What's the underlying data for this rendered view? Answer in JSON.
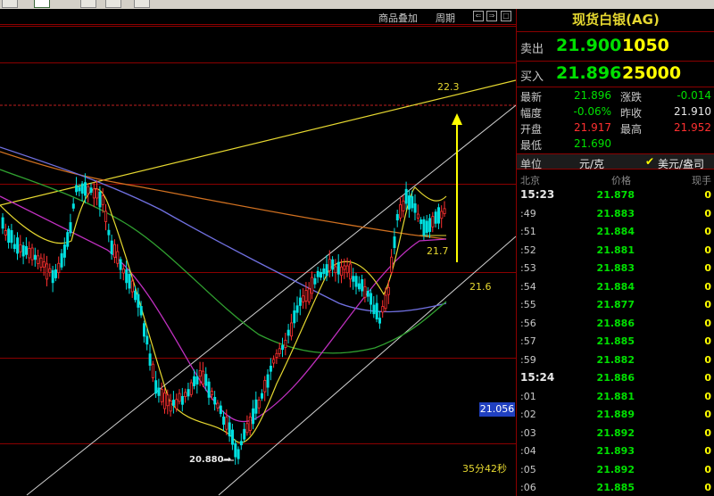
{
  "chart": {
    "header": {
      "overlay_label": "商品叠加",
      "period_label": "周期"
    },
    "annotations": {
      "upper_target": "22.3",
      "mid_level": "21.7",
      "support_level": "21.6",
      "low_marker": "20.880→",
      "current_price": "21.056",
      "countdown": "35分42秒"
    }
  },
  "quote": {
    "title": "现货白银(AG)",
    "sell": {
      "label": "卖出",
      "price": "21.900",
      "volume": "1050"
    },
    "buy": {
      "label": "买入",
      "price": "21.896",
      "volume": "25000"
    },
    "stats": {
      "latest": {
        "label": "最新",
        "value": "21.896"
      },
      "change": {
        "label": "涨跌",
        "value": "-0.014"
      },
      "amplitude": {
        "label": "幅度",
        "value": "-0.06%"
      },
      "prev_close": {
        "label": "昨收",
        "value": "21.910"
      },
      "open": {
        "label": "开盘",
        "value": "21.917"
      },
      "high": {
        "label": "最高",
        "value": "21.952"
      },
      "low": {
        "label": "最低",
        "value": "21.690"
      }
    },
    "unit": {
      "label": "单位",
      "value": "元/克",
      "currency": "美元/盎司"
    },
    "trades_header": {
      "time": "北京",
      "price": "价格",
      "volume": "现手"
    },
    "trades": [
      {
        "time": "15:23",
        "price": "21.878",
        "volume": "0"
      },
      {
        "time": ":49",
        "price": "21.883",
        "volume": "0"
      },
      {
        "time": ":51",
        "price": "21.884",
        "volume": "0"
      },
      {
        "time": ":52",
        "price": "21.881",
        "volume": "0"
      },
      {
        "time": ":53",
        "price": "21.883",
        "volume": "0"
      },
      {
        "time": ":54",
        "price": "21.884",
        "volume": "0"
      },
      {
        "time": ":55",
        "price": "21.877",
        "volume": "0"
      },
      {
        "time": ":56",
        "price": "21.886",
        "volume": "0"
      },
      {
        "time": ":57",
        "price": "21.885",
        "volume": "0"
      },
      {
        "time": ":59",
        "price": "21.882",
        "volume": "0"
      },
      {
        "time": "15:24",
        "price": "21.886",
        "volume": "0"
      },
      {
        "time": ":01",
        "price": "21.881",
        "volume": "0"
      },
      {
        "time": ":02",
        "price": "21.889",
        "volume": "0"
      },
      {
        "time": ":03",
        "price": "21.892",
        "volume": "0"
      },
      {
        "time": ":04",
        "price": "21.893",
        "volume": "0"
      },
      {
        "time": ":05",
        "price": "21.892",
        "volume": "0"
      },
      {
        "time": ":06",
        "price": "21.885",
        "volume": "0"
      }
    ]
  },
  "colors": {
    "up": "#ff3030",
    "down": "#00e0e0",
    "trend": "#e6d830",
    "grid_red": "#8b0000"
  }
}
